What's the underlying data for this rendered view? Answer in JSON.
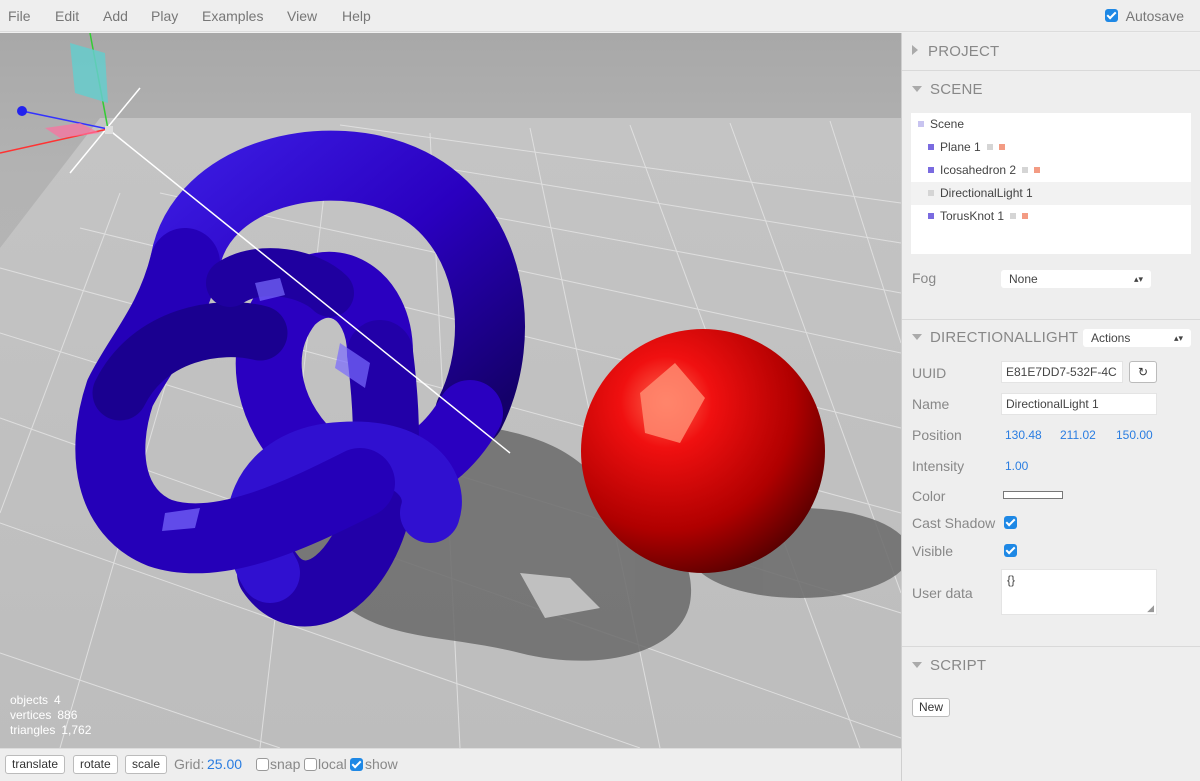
{
  "menubar": {
    "items": [
      "File",
      "Edit",
      "Add",
      "Play",
      "Examples",
      "View",
      "Help"
    ],
    "autosave_label": "Autosave",
    "autosave_checked": true
  },
  "viewport": {
    "info": {
      "objects_label": "objects",
      "objects_value": "4",
      "vertices_label": "vertices",
      "vertices_value": "886",
      "triangles_label": "triangles",
      "triangles_value": "1,762"
    }
  },
  "toolbar": {
    "translate": "translate",
    "rotate": "rotate",
    "scale": "scale",
    "grid_label": "Grid:",
    "grid_value": "25.00",
    "snap_label": "snap",
    "snap_checked": false,
    "local_label": "local",
    "local_checked": false,
    "show_label": "show",
    "show_checked": true
  },
  "sidebar": {
    "project_title": "PROJECT",
    "scene_title": "SCENE",
    "outliner": [
      {
        "label": "Scene",
        "type": "scene"
      },
      {
        "label": "Plane 1",
        "type": "mesh"
      },
      {
        "label": "Icosahedron 2",
        "type": "mesh"
      },
      {
        "label": "DirectionalLight 1",
        "type": "light",
        "selected": true
      },
      {
        "label": "TorusKnot 1",
        "type": "mesh"
      }
    ],
    "fog_label": "Fog",
    "fog_value": "None",
    "object_title": "DIRECTIONALLIGHT",
    "actions_label": "Actions",
    "uuid_label": "UUID",
    "uuid_value": "E81E7DD7-532F-4C",
    "name_label": "Name",
    "name_value": "DirectionalLight 1",
    "position_label": "Position",
    "position": [
      "130.48",
      "211.02",
      "150.00"
    ],
    "intensity_label": "Intensity",
    "intensity_value": "1.00",
    "color_label": "Color",
    "color_value": "#ffffff",
    "cast_shadow_label": "Cast Shadow",
    "cast_shadow_checked": true,
    "visible_label": "Visible",
    "visible_checked": true,
    "userdata_label": "User data",
    "userdata_value": "{}",
    "script_title": "SCRIPT",
    "new_label": "New"
  },
  "colors": {
    "accent": "#1e88e5",
    "number": "#2a7de1",
    "torus": "#2a00cc",
    "sphere": "#e00000",
    "mesh_icon": "#7a6be0",
    "light_icon": "#d5d5d5",
    "material_icon": "#f39b83"
  }
}
